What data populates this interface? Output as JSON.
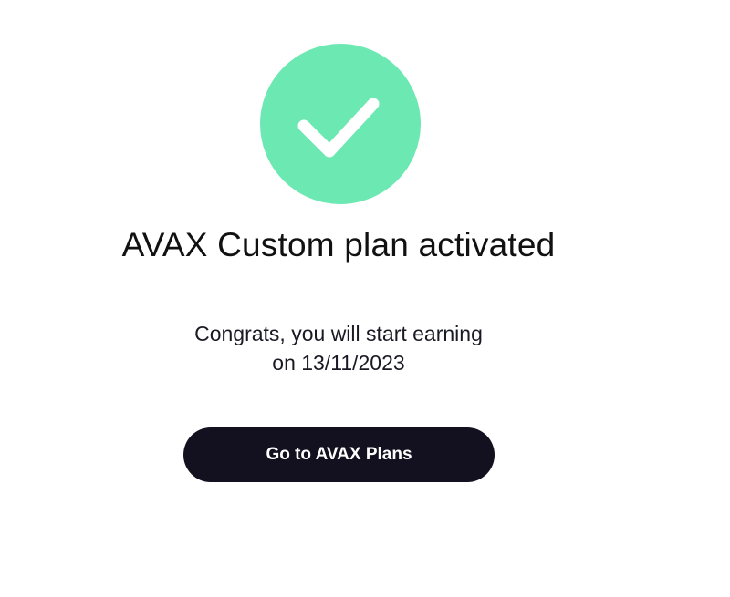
{
  "status": {
    "icon": "checkmark-icon",
    "circle_color": "#6ce8b2"
  },
  "title": "AVAX Custom plan activated",
  "message": {
    "line1": "Congrats, you will start earning",
    "line2": "on 13/11/2023"
  },
  "cta": {
    "label": "Go to AVAX Plans",
    "background": "#13111f",
    "text_color": "#ffffff"
  }
}
